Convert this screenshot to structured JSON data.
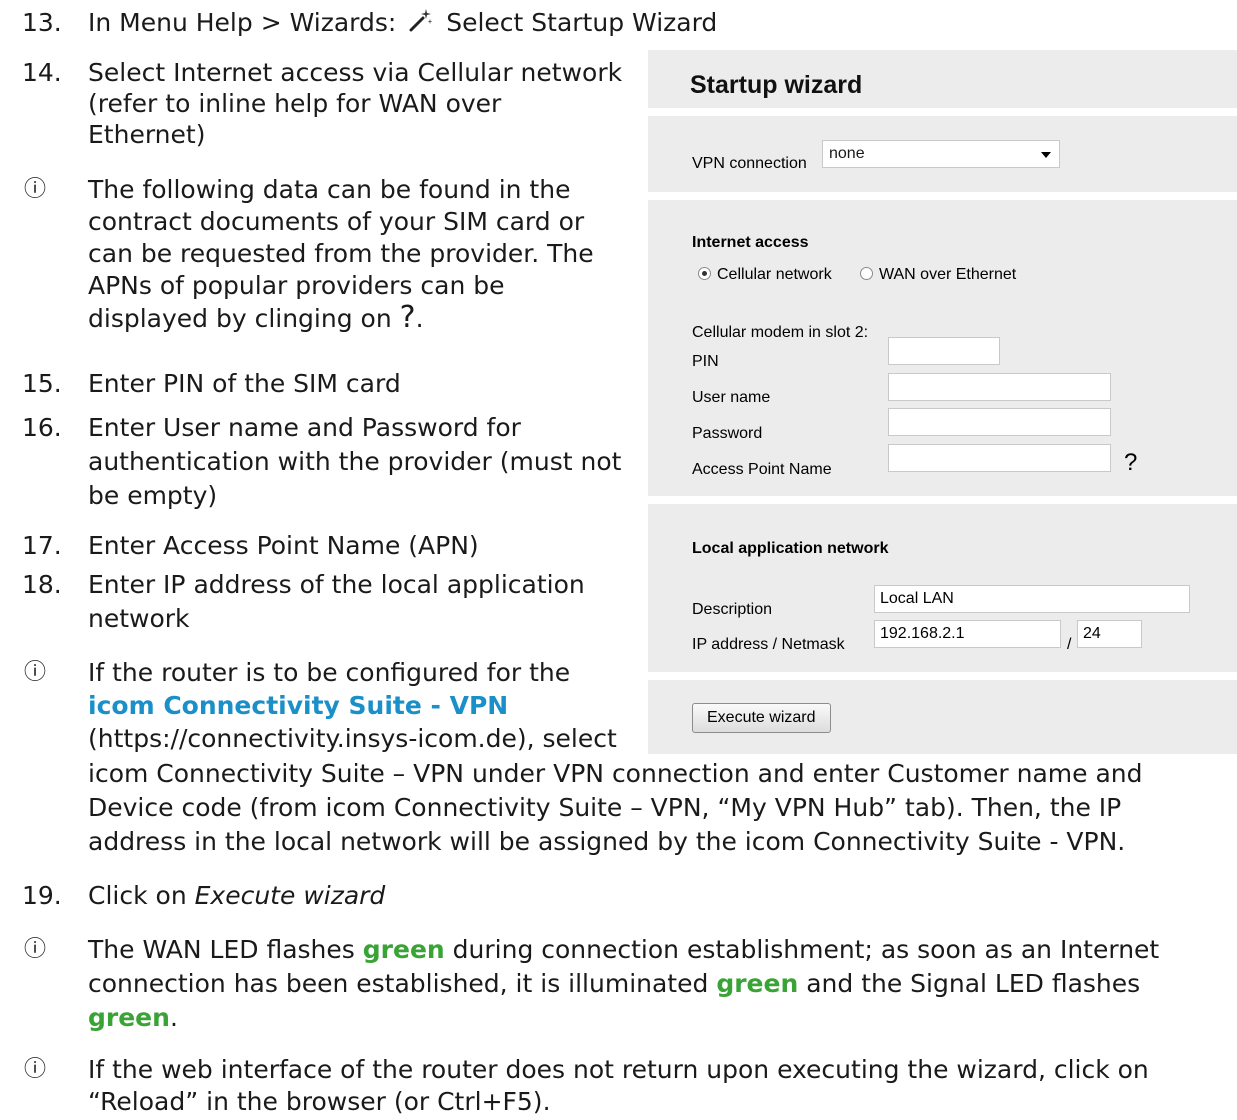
{
  "steps": {
    "s13": {
      "num": "13.",
      "pre": "In Menu Help > Wizards:",
      "post": "Select Startup Wizard"
    },
    "s14": {
      "num": "14.",
      "l1": "Select Internet access via Cellular network",
      "l2": "(refer to inline help for WAN over",
      "l3": "Ethernet)"
    },
    "i1": {
      "icon": "ⓘ",
      "l1": "The following data can be found in the",
      "l2": "contract documents of your SIM card or",
      "l3": "can be requested from the provider. The",
      "l4": "APNs of popular providers can be",
      "l5a": "displayed by clinging on",
      "q": "?",
      "l5b": "."
    },
    "s15": {
      "num": "15.",
      "text": "Enter PIN of the SIM card"
    },
    "s16": {
      "num": "16.",
      "l1": "Enter User name and Password for",
      "l2": "authentication with the provider (must not",
      "l3": "be empty)"
    },
    "s17": {
      "num": "17.",
      "text": "Enter Access Point Name (APN)"
    },
    "s18": {
      "num": "18.",
      "l1": "Enter IP address of the local application",
      "l2": "network"
    },
    "i2": {
      "icon": "ⓘ",
      "l1": "If the router is to be configured for the",
      "l2": "icom Connectivity Suite - VPN",
      "l3": "(https://connectivity.insys-icom.de), select",
      "l4": "icom Connectivity Suite – VPN under VPN connection and enter Customer name and",
      "l5": "Device code (from icom Connectivity Suite – VPN, “My VPN Hub” tab). Then, the IP",
      "l6": "address in the local network will be assigned by the icom Connectivity Suite - VPN."
    },
    "s19": {
      "num": "19.",
      "pre": "Click on",
      "em": "Execute wizard"
    },
    "i3": {
      "icon": "ⓘ",
      "a": "The WAN LED flashes",
      "g1": "green",
      "b": "during connection establishment; as soon as an Internet",
      "c": "connection has been established, it is illuminated",
      "g2": "green",
      "d": "and the Signal LED flashes",
      "g3": "green",
      "e": "."
    },
    "i4": {
      "icon": "ⓘ",
      "l1": "If the web interface of the router does not return upon executing the wizard, click on",
      "l2": "“Reload” in the browser (or Ctrl+F5)."
    }
  },
  "wizard": {
    "title": "Startup wizard",
    "vpn_label": "VPN connection",
    "vpn_value": "none",
    "internet_title": "Internet access",
    "radio_cellular": "Cellular network",
    "radio_wan": "WAN over Ethernet",
    "modem_label": "Cellular modem in slot 2:",
    "pin_label": "PIN",
    "user_label": "User name",
    "password_label": "Password",
    "apn_label": "Access Point Name",
    "help_q": "?",
    "lan_title": "Local application network",
    "desc_label": "Description",
    "desc_value": "Local LAN",
    "ip_label": "IP address / Netmask",
    "ip_value": "192.168.2.1",
    "slash": "/",
    "mask_value": "24",
    "execute_label": "Execute wizard"
  }
}
